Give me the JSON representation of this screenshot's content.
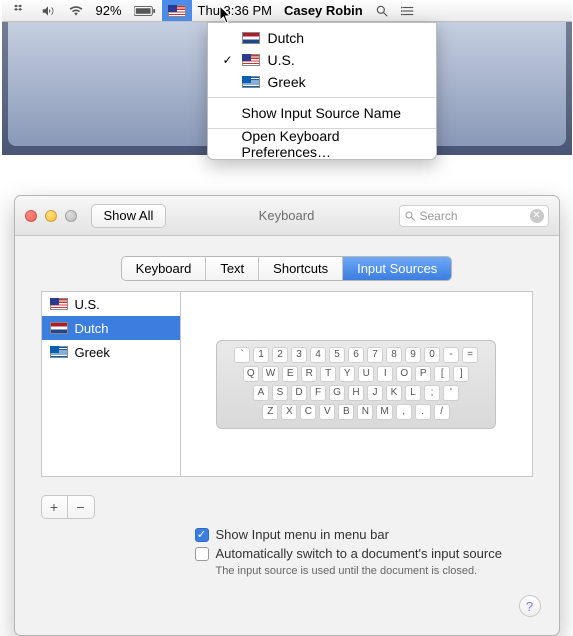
{
  "menubar": {
    "battery_percent": "92%",
    "clock": "Thu 3:36 PM",
    "user": "Casey Robin"
  },
  "input_menu": {
    "items": [
      {
        "label": "Dutch",
        "checked": false,
        "flag": "nl"
      },
      {
        "label": "U.S.",
        "checked": true,
        "flag": "us"
      },
      {
        "label": "Greek",
        "checked": false,
        "flag": "gr"
      }
    ],
    "show_name": "Show Input Source Name",
    "open_prefs": "Open Keyboard Preferences…"
  },
  "window": {
    "show_all": "Show All",
    "title": "Keyboard",
    "search_placeholder": "Search",
    "tabs": [
      "Keyboard",
      "Text",
      "Shortcuts",
      "Input Sources"
    ],
    "active_tab": 3,
    "sources": [
      {
        "label": "U.S.",
        "flag": "us",
        "selected": false
      },
      {
        "label": "Dutch",
        "flag": "nl",
        "selected": true
      },
      {
        "label": "Greek",
        "flag": "gr",
        "selected": false
      }
    ],
    "keyboard_rows": [
      [
        "`",
        "1",
        "2",
        "3",
        "4",
        "5",
        "6",
        "7",
        "8",
        "9",
        "0",
        "-",
        "="
      ],
      [
        "Q",
        "W",
        "E",
        "R",
        "T",
        "Y",
        "U",
        "I",
        "O",
        "P",
        "[",
        "]"
      ],
      [
        "A",
        "S",
        "D",
        "F",
        "G",
        "H",
        "J",
        "K",
        "L",
        ";",
        "'"
      ],
      [
        "Z",
        "X",
        "C",
        "V",
        "B",
        "N",
        "M",
        ",",
        ".",
        "/"
      ]
    ],
    "check1": "Show Input menu in menu bar",
    "check1_on": true,
    "check2": "Automatically switch to a document's input source",
    "check2_on": false,
    "hint": "The input source is used until the document is closed.",
    "help": "?"
  }
}
